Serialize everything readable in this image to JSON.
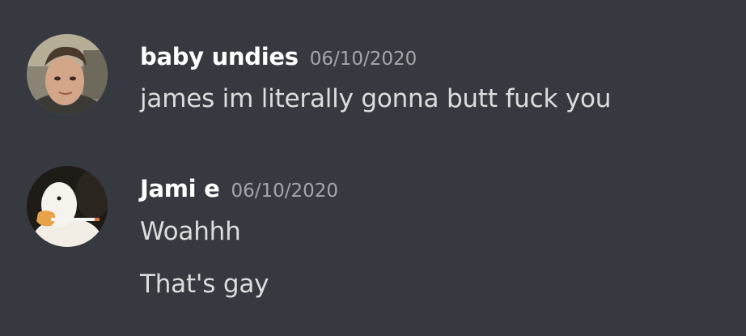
{
  "messages": [
    {
      "avatar_icon": "profile-photo-man-avatar",
      "username": "baby undies",
      "timestamp": "06/10/2020",
      "lines": [
        "james im literally gonna butt fuck you"
      ]
    },
    {
      "avatar_icon": "duck-with-cigarette-avatar",
      "username": "Jami e",
      "timestamp": "06/10/2020",
      "lines": [
        "Woahhh",
        "That's gay"
      ]
    }
  ],
  "colors": {
    "background": "#36393f",
    "username": "#ffffff",
    "timestamp": "#a3a6aa",
    "message_text": "#dcddde"
  }
}
